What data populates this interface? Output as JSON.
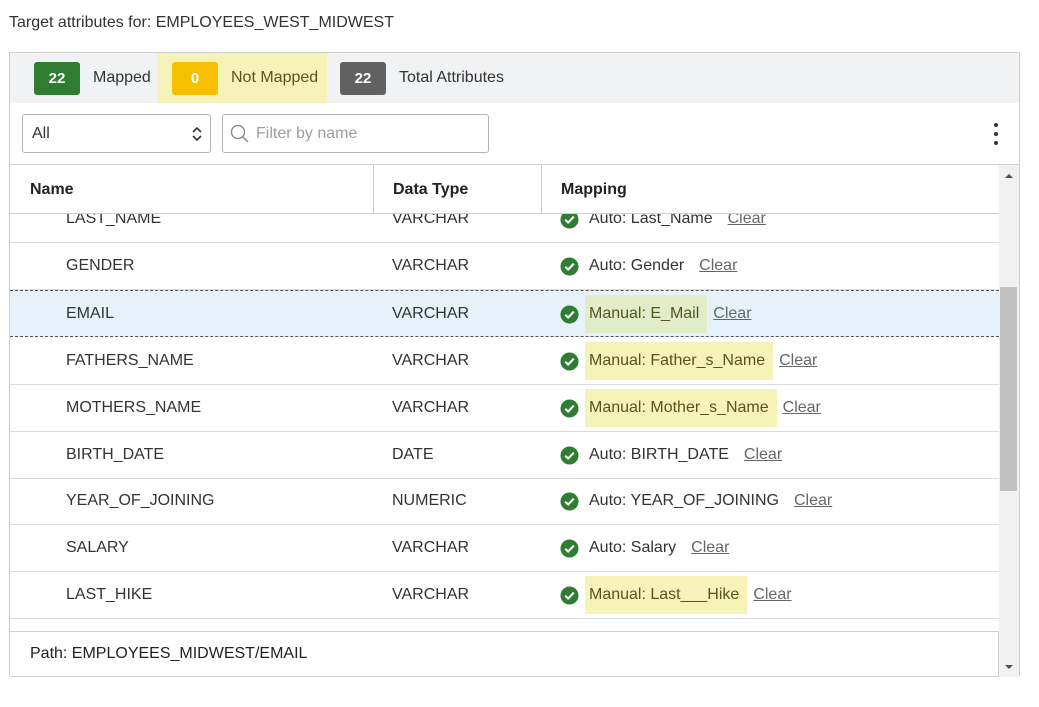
{
  "title": "Target attributes for: EMPLOYEES_WEST_MIDWEST",
  "stats": {
    "mapped_count": "22",
    "mapped_label": "Mapped",
    "not_mapped_count": "0",
    "not_mapped_label": "Not Mapped",
    "total_count": "22",
    "total_label": "Total Attributes"
  },
  "filters": {
    "select_value": "All",
    "search_placeholder": "Filter by name"
  },
  "table": {
    "headers": [
      "Name",
      "Data Type",
      "Mapping"
    ],
    "clear_label": "Clear",
    "rows": [
      {
        "name": "LAST_NAME",
        "type": "VARCHAR",
        "mapping": "Auto: Last_Name",
        "manual": false,
        "selected": false
      },
      {
        "name": "GENDER",
        "type": "VARCHAR",
        "mapping": "Auto: Gender",
        "manual": false,
        "selected": false
      },
      {
        "name": "EMAIL",
        "type": "VARCHAR",
        "mapping": "Manual: E_Mail",
        "manual": true,
        "selected": true
      },
      {
        "name": "FATHERS_NAME",
        "type": "VARCHAR",
        "mapping": "Manual: Father_s_Name",
        "manual": true,
        "selected": false
      },
      {
        "name": "MOTHERS_NAME",
        "type": "VARCHAR",
        "mapping": "Manual: Mother_s_Name",
        "manual": true,
        "selected": false
      },
      {
        "name": "BIRTH_DATE",
        "type": "DATE",
        "mapping": "Auto: BIRTH_DATE",
        "manual": false,
        "selected": false
      },
      {
        "name": "YEAR_OF_JOINING",
        "type": "NUMERIC",
        "mapping": "Auto: YEAR_OF_JOINING",
        "manual": false,
        "selected": false
      },
      {
        "name": "SALARY",
        "type": "VARCHAR",
        "mapping": "Auto: Salary",
        "manual": false,
        "selected": false
      },
      {
        "name": "LAST_HIKE",
        "type": "VARCHAR",
        "mapping": "Manual: Last___Hike",
        "manual": true,
        "selected": false
      }
    ]
  },
  "path": "Path: EMPLOYEES_MIDWEST/EMAIL",
  "colors": {
    "mapped": "#2e7d32",
    "not_mapped": "#f6bf00",
    "total": "#616161",
    "manual_highlight": "#f6f3b8",
    "selected_row": "#e6f1fa"
  },
  "icons": {
    "status": "check-circle-icon",
    "search": "search-icon",
    "more": "more-vertical-icon",
    "select": "chevron-up-down-icon"
  }
}
